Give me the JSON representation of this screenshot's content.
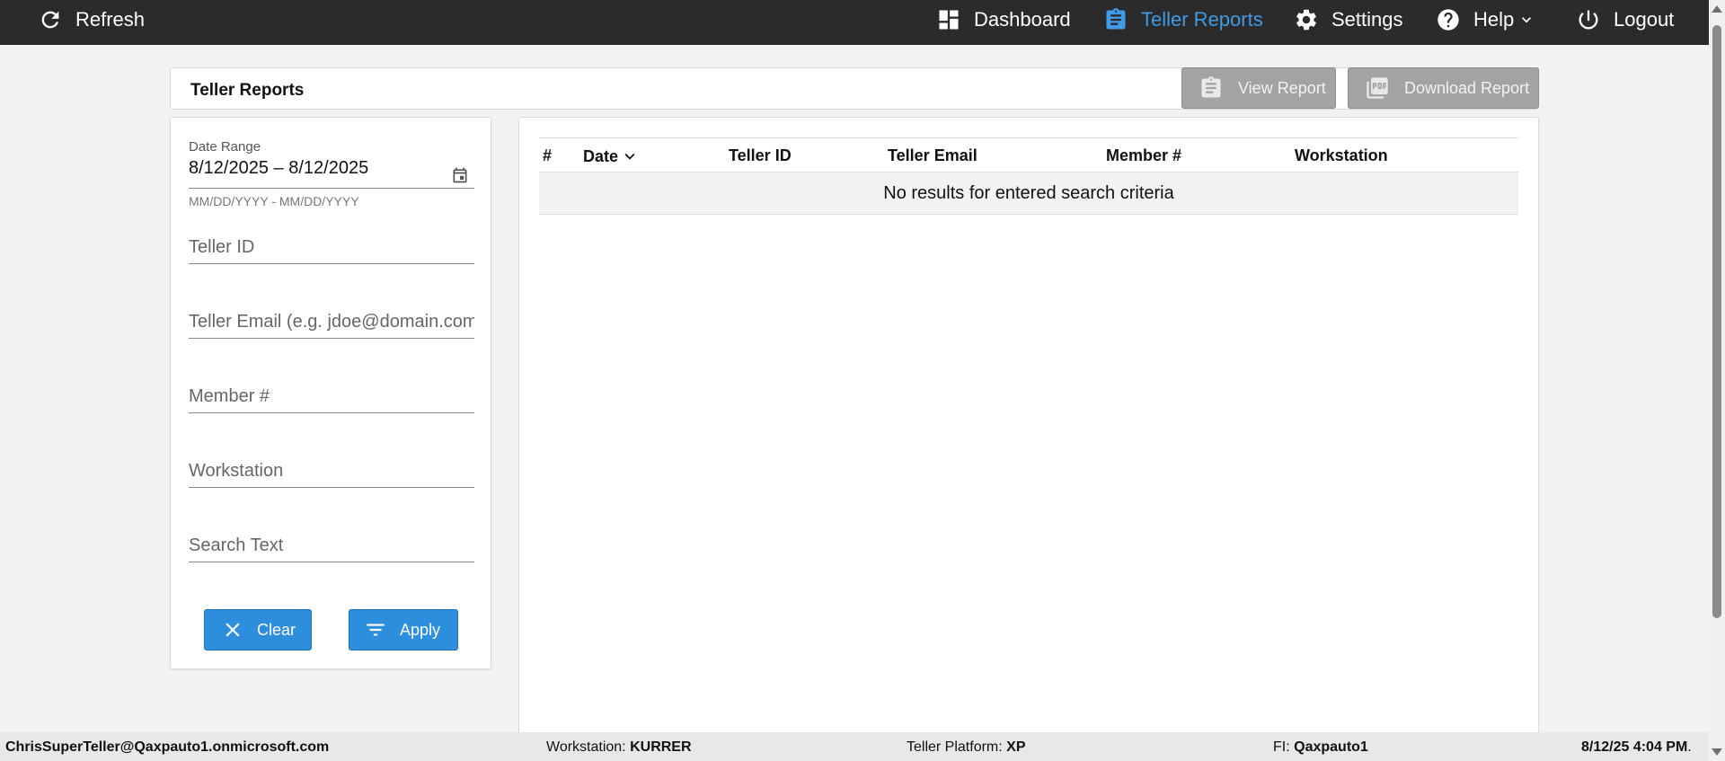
{
  "nav": {
    "refresh": "Refresh",
    "dashboard": "Dashboard",
    "teller_reports": "Teller Reports",
    "settings": "Settings",
    "help": "Help",
    "logout": "Logout",
    "active_color": "#3f9be6"
  },
  "header": {
    "title": "Teller Reports",
    "view_report": "View Report",
    "download_report": "Download Report"
  },
  "filters": {
    "date_range_label": "Date Range",
    "date_range_value": "8/12/2025 – 8/12/2025",
    "date_range_hint": "MM/DD/YYYY - MM/DD/YYYY",
    "teller_id_placeholder": "Teller ID",
    "teller_email_placeholder": "Teller Email (e.g. jdoe@domain.com)",
    "member_placeholder": "Member #",
    "workstation_placeholder": "Workstation",
    "search_text_placeholder": "Search Text",
    "clear": "Clear",
    "apply": "Apply"
  },
  "table": {
    "columns": [
      "#",
      "Date",
      "Teller ID",
      "Teller Email",
      "Member #",
      "Workstation"
    ],
    "empty_message": "No results for entered search criteria"
  },
  "status": {
    "user": "ChrisSuperTeller@Qaxpauto1.onmicrosoft.com",
    "workstation_label": "Workstation:",
    "workstation_value": "KURRER",
    "platform_label": "Teller Platform:",
    "platform_value": "XP",
    "fi_label": "FI:",
    "fi_value": "Qaxpauto1",
    "datetime": "8/12/25 4:04 PM",
    "datetime_suffix": "."
  },
  "colors": {
    "topbar": "#2b2b2b",
    "primary_button": "#2e8ede",
    "disabled_button": "#a3a3a3"
  }
}
